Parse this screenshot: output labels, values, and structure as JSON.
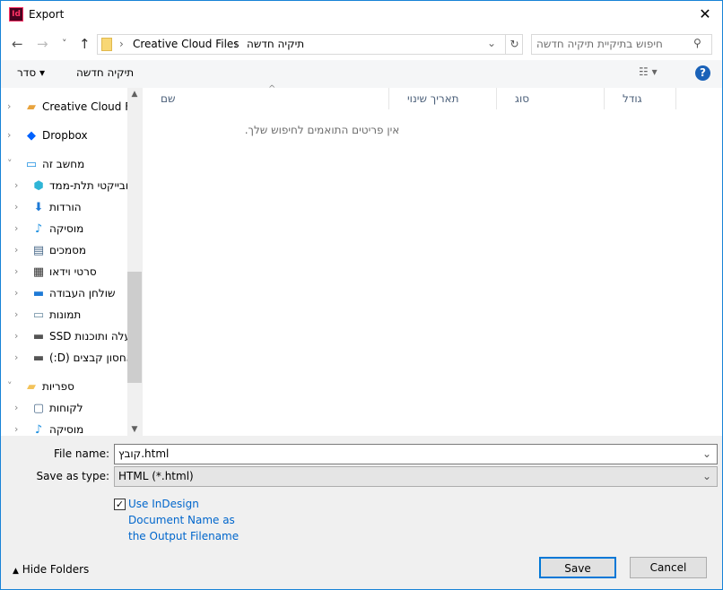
{
  "window": {
    "title": "Export",
    "app_icon": "Id",
    "close": "✕"
  },
  "nav": {
    "back": "←",
    "forward": "→",
    "recent": "˅",
    "up": "↑",
    "refresh": "↻"
  },
  "address": {
    "segments": [
      "Creative Cloud Files",
      "תיקיה חדשה"
    ]
  },
  "search": {
    "placeholder": "חיפוש בתיקיית  תיקיה חדשה"
  },
  "toolbar": {
    "organize": "סדר",
    "new_folder": "תיקיה חדשה",
    "help": "?"
  },
  "sidebar": {
    "items": [
      {
        "label": "Creative Cloud Fil",
        "icon": "creative-cloud-icon",
        "expand": "›"
      },
      {
        "label": "Dropbox",
        "icon": "dropbox-icon",
        "expand": "›"
      },
      {
        "label": "מחשב זה",
        "icon": "computer-icon",
        "expand": "˅"
      },
      {
        "label": "אובייקטי תלת-ממד",
        "icon": "3d-objects-icon",
        "expand": "›"
      },
      {
        "label": "הורדות",
        "icon": "downloads-icon",
        "expand": "›"
      },
      {
        "label": "מוסיקה",
        "icon": "music-icon",
        "expand": "›"
      },
      {
        "label": "מסמכים",
        "icon": "documents-icon",
        "expand": "›"
      },
      {
        "label": "סרטי וידאו",
        "icon": "videos-icon",
        "expand": "›"
      },
      {
        "label": "שולחן העבודה",
        "icon": "desktop-icon",
        "expand": "›"
      },
      {
        "label": "תמונות",
        "icon": "pictures-icon",
        "expand": "›"
      },
      {
        "label": "עלה ותוכנות SSD",
        "icon": "drive-icon",
        "expand": "›"
      },
      {
        "label": "אחסון קבצים (D:)",
        "icon": "drive-icon",
        "expand": "›"
      },
      {
        "label": "ספריות",
        "icon": "libraries-icon",
        "expand": "˅"
      },
      {
        "label": "לקוחות",
        "icon": "library-icon",
        "expand": "›"
      },
      {
        "label": "מוסיקה",
        "icon": "music-icon",
        "expand": "›"
      }
    ]
  },
  "columns": [
    "שם",
    "תאריך שינוי",
    "סוג",
    "גודל"
  ],
  "empty_message": "אין פריטים התואמים לחיפוש שלך.",
  "form": {
    "file_name_label": "File name:",
    "file_name": "קובץ.html",
    "type_label": "Save as type:",
    "type": "HTML (*.html)",
    "checkbox_label": [
      "Use InDesign",
      "Document Name as",
      "the Output Filename"
    ],
    "checkbox_checked": true
  },
  "footer": {
    "hide_folders": "Hide Folders",
    "save": "Save",
    "cancel": "Cancel"
  }
}
